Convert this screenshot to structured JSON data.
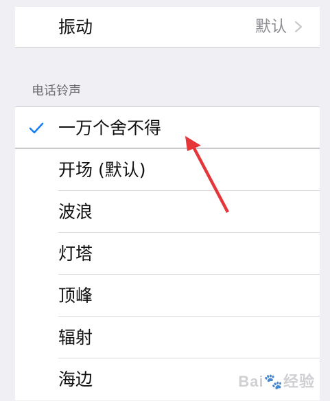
{
  "vibration": {
    "label": "振动",
    "value": "默认"
  },
  "ringtones": {
    "header": "电话铃声",
    "selected_index": 0,
    "items": [
      {
        "label": "一万个舍不得"
      },
      {
        "label": "开场 (默认)"
      },
      {
        "label": "波浪"
      },
      {
        "label": "灯塔"
      },
      {
        "label": "顶峰"
      },
      {
        "label": "辐射"
      },
      {
        "label": "海边"
      }
    ]
  },
  "colors": {
    "accent": "#1a7ef7",
    "annotation_arrow": "#e5363a"
  },
  "watermark": {
    "text": "Bai",
    "paw": "🐾",
    "suffix": "经验"
  }
}
